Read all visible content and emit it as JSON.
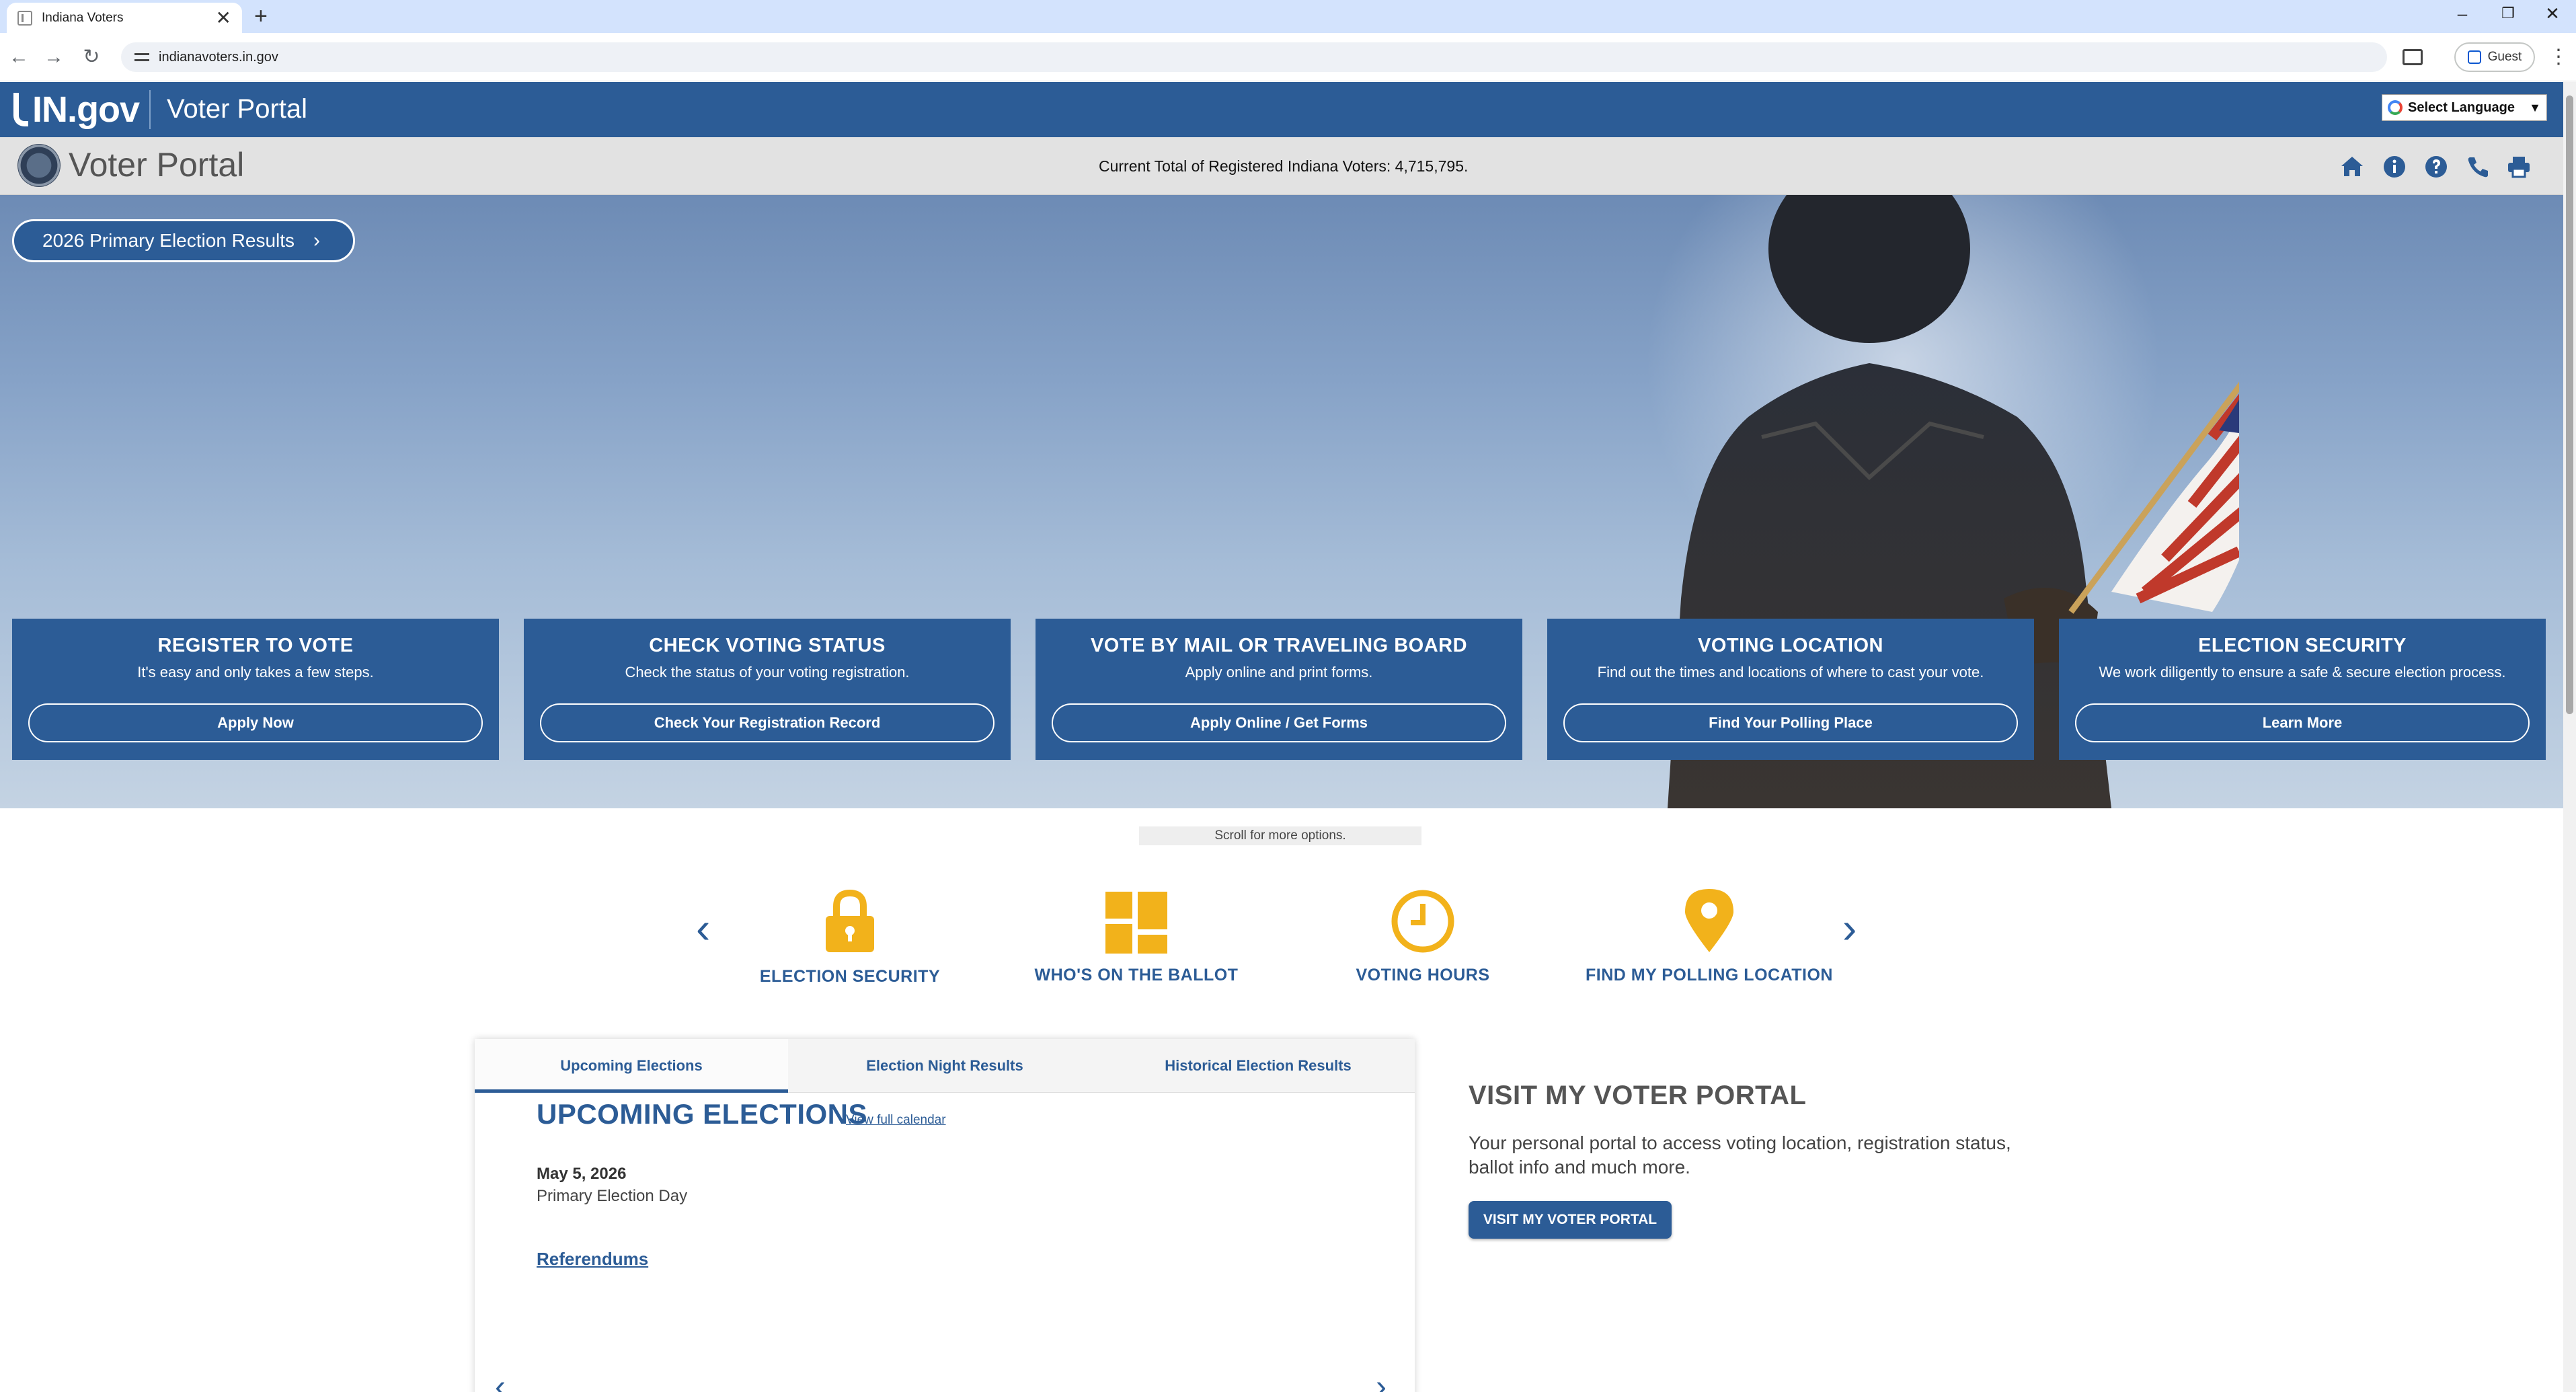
{
  "browser": {
    "tab_title": "Indiana Voters",
    "url": "indianavoters.in.gov",
    "profile_label": "Guest",
    "new_tab_symbol": "+",
    "close_symbol": "✕",
    "back_symbol": "←",
    "forward_symbol": "→",
    "reload_symbol": "↻",
    "minimize_symbol": "–",
    "restore_symbol": "❐",
    "window_close_symbol": "✕",
    "menu_symbol": "⋮"
  },
  "ingov": {
    "logo_text": "IN.gov",
    "site_title": "Voter Portal",
    "language_label": "Select Language",
    "language_caret": "▼"
  },
  "portal": {
    "title": "Voter Portal",
    "voter_total": "Current Total of Registered Indiana Voters: 4,715,795.",
    "icons": [
      "home-icon",
      "info-icon",
      "help-icon",
      "phone-icon",
      "print-icon"
    ]
  },
  "hero": {
    "results_button": "2026 Primary Election Results",
    "results_chevron": "›",
    "cards": [
      {
        "title": "REGISTER TO VOTE",
        "desc": "It's easy and only takes a few steps.",
        "button": "Apply Now"
      },
      {
        "title": "CHECK VOTING STATUS",
        "desc": "Check the status of your voting registration.",
        "button": "Check Your Registration Record"
      },
      {
        "title": "VOTE BY MAIL OR TRAVELING BOARD",
        "desc": "Apply online and print forms.",
        "button": "Apply Online / Get Forms"
      },
      {
        "title": "VOTING LOCATION",
        "desc": "Find out the times and locations of where to cast your vote.",
        "button": "Find Your Polling Place"
      },
      {
        "title": "ELECTION SECURITY",
        "desc": "We work diligently to ensure a safe & secure election process.",
        "button": "Learn More"
      }
    ]
  },
  "quick_links": {
    "scroll_hint": "Scroll for more options.",
    "prev_symbol": "‹",
    "next_symbol": "›",
    "icon_color": "#f2b21b",
    "items": [
      {
        "label": "ELECTION SECURITY",
        "icon": "lock-icon"
      },
      {
        "label": "WHO'S ON THE BALLOT",
        "icon": "ballot-grid-icon"
      },
      {
        "label": "VOTING HOURS",
        "icon": "clock-icon"
      },
      {
        "label": "FIND MY POLLING LOCATION",
        "icon": "map-pin-icon"
      }
    ]
  },
  "elections": {
    "tabs": [
      "Upcoming Elections",
      "Election Night Results",
      "Historical Election Results"
    ],
    "active_tab": "Upcoming Elections",
    "heading": "UPCOMING ELECTIONS",
    "calendar_link": "View full calendar",
    "event_date": "May 5, 2026",
    "event_name": "Primary Election Day",
    "referendums_link": "Referendums",
    "prev_symbol": "‹",
    "next_symbol": "›"
  },
  "promo": {
    "title": "VISIT MY VOTER PORTAL",
    "text": "Your personal portal to access voting location, registration status, ballot info and much more.",
    "button": "VISIT MY VOTER PORTAL"
  },
  "colors": {
    "brand_blue": "#2c5c96",
    "accent_gold": "#f2b21b",
    "header_gray": "#e2e2e2"
  }
}
